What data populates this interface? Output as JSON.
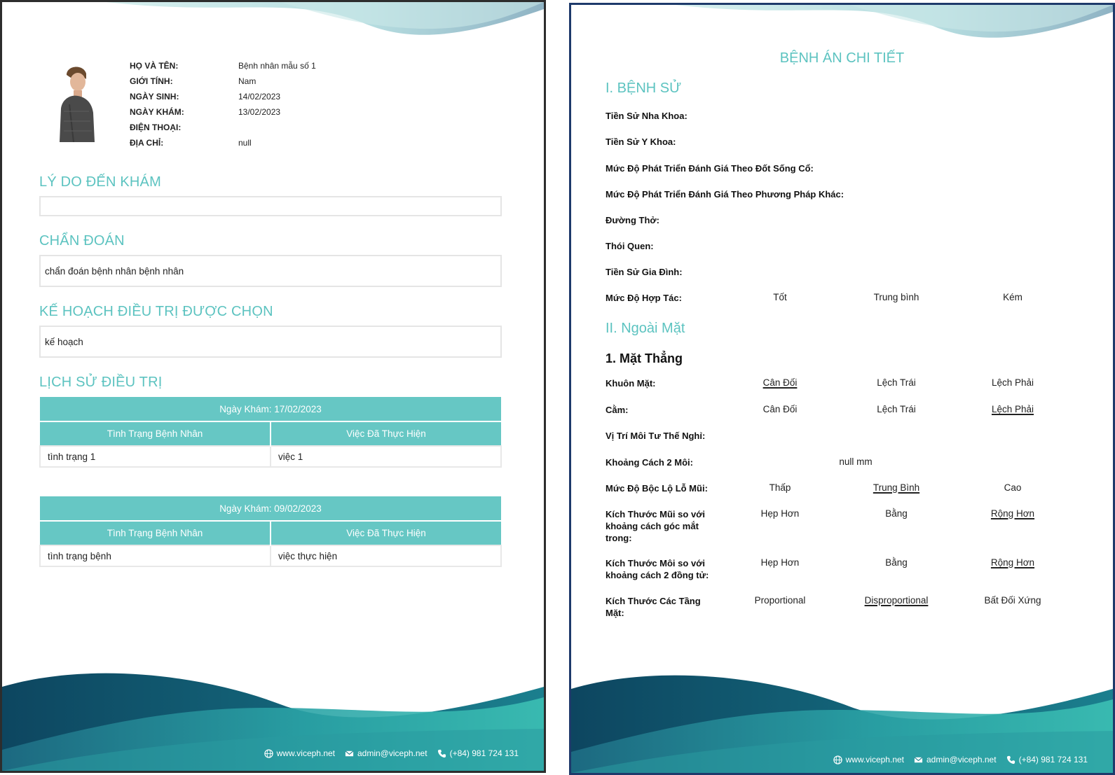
{
  "page1": {
    "patient": {
      "rows": [
        {
          "label": "HỌ VÀ TÊN:",
          "value": "Bệnh nhân mẫu số 1"
        },
        {
          "label": "GIỚI TÍNH:",
          "value": "Nam"
        },
        {
          "label": "NGÀY SINH:",
          "value": "14/02/2023"
        },
        {
          "label": "NGÀY KHÁM:",
          "value": "13/02/2023"
        },
        {
          "label": "ĐIỆN THOẠI:",
          "value": ""
        },
        {
          "label": "ĐỊA CHỈ:",
          "value": "null"
        }
      ]
    },
    "reason": {
      "title": "LÝ DO ĐẾN KHÁM",
      "value": ""
    },
    "diagnosis": {
      "title": "CHẨN ĐOÁN",
      "value": "chẩn đoán bệnh nhân bệnh nhân"
    },
    "plan": {
      "title": "KẾ HOẠCH ĐIỀU TRỊ ĐƯỢC CHỌN",
      "value": "kế hoạch"
    },
    "history": {
      "title": "LỊCH SỬ ĐIỀU TRỊ",
      "col_status": "Tình Trạng Bệnh Nhân",
      "col_done": "Việc Đã Thực Hiện",
      "visits": [
        {
          "date": "Ngày Khám: 17/02/2023",
          "status": "tình trạng 1",
          "done": "việc 1"
        },
        {
          "date": "Ngày Khám: 09/02/2023",
          "status": "tình trạng bệnh",
          "done": "việc thực hiện"
        }
      ]
    }
  },
  "footer": {
    "website": "www.viceph.net",
    "email": "admin@viceph.net",
    "phone": "(+84) 981 724 131"
  },
  "page2": {
    "title": "BỆNH ÁN CHI TIẾT",
    "section1": "I. BỆNH SỬ",
    "history_fields": [
      "Tiền Sử Nha Khoa:",
      "Tiền Sử Y Khoa:",
      "Mức Độ Phát Triển Đánh Giá Theo Đốt Sống Cổ:",
      "Mức Độ Phát Triển Đánh Giá Theo Phương Pháp Khác:",
      "Đường Thở:",
      "Thói Quen:",
      "Tiền Sử Gia Đình:"
    ],
    "cooperation": {
      "label": "Mức Độ Hợp Tác:",
      "options": [
        "Tốt",
        "Trung bình",
        "Kém"
      ]
    },
    "section2": "II. Ngoài Mặt",
    "subsection": "1. Mặt Thẳng",
    "face": {
      "label": "Khuôn Mặt:",
      "options": [
        "Cân Đối",
        "Lệch Trái",
        "Lệch Phải"
      ],
      "selected": "Cân Đối"
    },
    "chin": {
      "label": "Cằm:",
      "options": [
        "Cân Đối",
        "Lệch Trái",
        "Lệch Phải"
      ],
      "selected": "Lệch Phải"
    },
    "lip_rest": {
      "label": "Vị Trí Môi Tư Thế Nghỉ:"
    },
    "lip_gap": {
      "label": "Khoảng Cách 2 Môi:",
      "value": "null mm"
    },
    "nostril": {
      "label": "Mức Độ Bộc Lộ Lỗ Mũi:",
      "options": [
        "Thấp",
        "Trung Bình",
        "Cao"
      ],
      "selected": "Trung Bình"
    },
    "nose_width": {
      "label": "Kích Thước Mũi so với khoảng cách góc mắt trong:",
      "options": [
        "Hẹp Hơn",
        "Bằng",
        "Rộng Hơn"
      ],
      "selected": "Rộng Hơn"
    },
    "mouth_width": {
      "label": "Kích Thước Môi so với khoảng cách 2 đồng tử:",
      "options": [
        "Hẹp Hơn",
        "Bằng",
        "Rộng Hơn"
      ],
      "selected": "Rộng Hơn"
    },
    "face_thirds": {
      "label": "Kích Thước Các Tầng Mặt:",
      "options": [
        "Proportional",
        "Disproportional",
        "Bất Đối Xứng"
      ],
      "selected": "Disproportional"
    }
  }
}
